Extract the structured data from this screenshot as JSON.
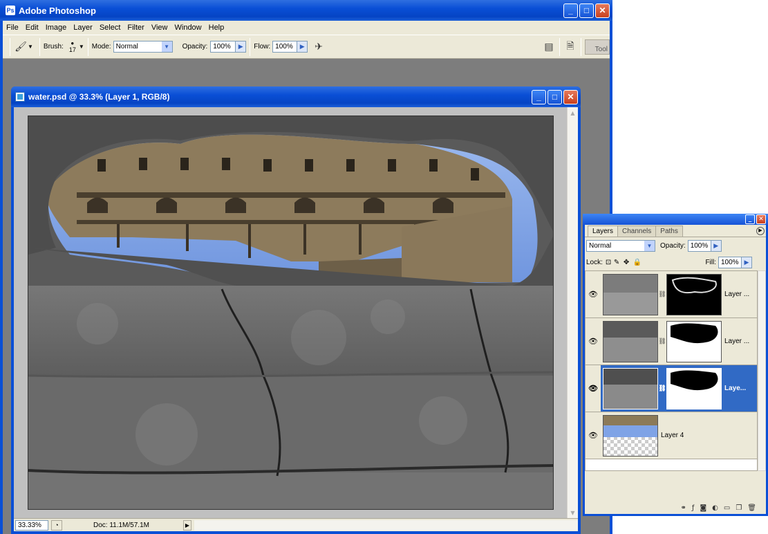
{
  "app": {
    "title": "Adobe Photoshop"
  },
  "menu": [
    "File",
    "Edit",
    "Image",
    "Layer",
    "Select",
    "Filter",
    "View",
    "Window",
    "Help"
  ],
  "options": {
    "brush_label": "Brush:",
    "brush_size": "17",
    "mode_label": "Mode:",
    "mode_value": "Normal",
    "opacity_label": "Opacity:",
    "opacity_value": "100%",
    "flow_label": "Flow:",
    "flow_value": "100%",
    "tool_tab": "Tool"
  },
  "document": {
    "title": "water.psd @ 33.3% (Layer 1, RGB/8)",
    "zoom": "33.33%",
    "doc_info": "Doc: 11.1M/57.1M"
  },
  "layers_panel": {
    "tabs": [
      "Layers",
      "Channels",
      "Paths"
    ],
    "blend_mode": "Normal",
    "opacity_label": "Opacity:",
    "opacity_value": "100%",
    "lock_label": "Lock:",
    "fill_label": "Fill:",
    "fill_value": "100%",
    "layers": [
      {
        "name": "Layer ...",
        "has_mask": true,
        "selected": false
      },
      {
        "name": "Layer ...",
        "has_mask": true,
        "selected": false
      },
      {
        "name": "Laye...",
        "has_mask": true,
        "selected": true
      },
      {
        "name": "Layer 4",
        "has_mask": false,
        "selected": false
      }
    ]
  },
  "colors": {
    "xp_blue": "#0a4fd6",
    "panel_bg": "#ece9d8",
    "selection": "#316ac5",
    "workspace": "#7d7d7d"
  }
}
